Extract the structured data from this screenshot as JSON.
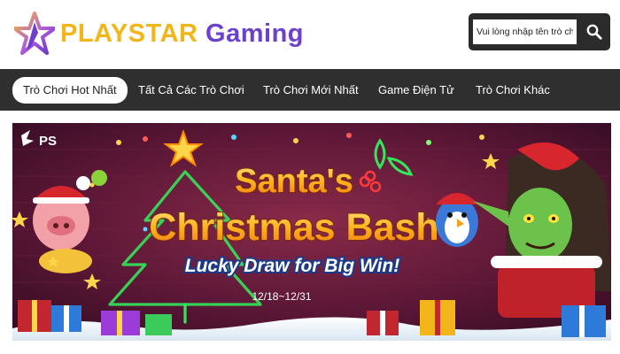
{
  "header": {
    "logo": {
      "part1": "PLAYSTAR",
      "part2": "Gaming",
      "icon": "star-logo-icon"
    },
    "search": {
      "placeholder": "Vui lòng nhập tên trò chơi.",
      "icon": "search-icon"
    }
  },
  "nav": {
    "items": [
      {
        "label": "Trò Chơi Hot Nhất",
        "active": true
      },
      {
        "label": "Tất Cả Các Trò Chơi",
        "active": false
      },
      {
        "label": "Trò Chơi Mới Nhất",
        "active": false
      },
      {
        "label": "Game Điện Tử",
        "active": false
      },
      {
        "label": "Trò Chơi Khác",
        "active": false
      }
    ]
  },
  "banner": {
    "brand": "PS",
    "title_line1": "Santa's",
    "title_line2": "Christmas Bash",
    "subtitle": "Lucky Draw for Big Win!",
    "dates": "12/18~12/31"
  },
  "colors": {
    "brand_yellow": "#f2b51a",
    "brand_purple": "#6b3fd0",
    "nav_bg": "#2f2f2f",
    "banner_title": "#ffb21e"
  }
}
